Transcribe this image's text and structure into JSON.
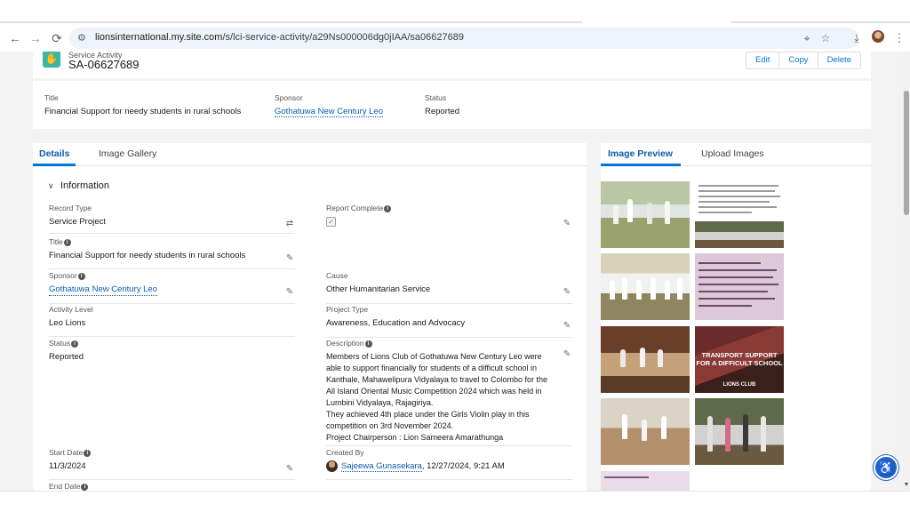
{
  "browser": {
    "url_host": "lionsinternational.my.site.com",
    "url_path": "/s/lci-service-activity/a29Ns000006dg0jIAA/sa06627689",
    "icons": [
      "back-icon",
      "forward-icon",
      "reload-icon",
      "site-info-icon",
      "location-icon",
      "star-icon",
      "download-icon",
      "menu-icon"
    ]
  },
  "record": {
    "object_type": "Service Activity",
    "name": "SA-06627689",
    "actions": [
      "Edit",
      "Copy",
      "Delete"
    ]
  },
  "highlights": [
    {
      "label": "Title",
      "value": "Financial Support for needy students in rural schools"
    },
    {
      "label": "Sponsor",
      "value": "Gothatuwa New Century Leo"
    },
    {
      "label": "Status",
      "value": "Reported"
    }
  ],
  "details": {
    "tabs": [
      "Details",
      "Image Gallery"
    ],
    "section": "Information",
    "fields": {
      "record_type": {
        "label": "Record Type",
        "value": "Service Project"
      },
      "report_complete": {
        "label": "Report Complete",
        "value": "✓"
      },
      "title": {
        "label": "Title",
        "value": "Financial Support for needy students in rural schools"
      },
      "sponsor": {
        "label": "Sponsor",
        "value": "Gothatuwa New Century Leo"
      },
      "cause": {
        "label": "Cause",
        "value": "Other Humanitarian Service"
      },
      "activity_level": {
        "label": "Activity Level",
        "value": "Leo Lions"
      },
      "project_type": {
        "label": "Project Type",
        "value": "Awareness, Education and Advocacy"
      },
      "status": {
        "label": "Status",
        "value": "Reported"
      },
      "description": {
        "label": "Description",
        "lines": [
          "Members of Lions Club of Gothatuwa New Century Leo were",
          "able to support financially for students of a difficult school in",
          "Kanthale, Mahawelipura Vidyalaya to travel to Colombo for the",
          "All Island Oriental Music Competition 2024 which was held in",
          "Lumbini Vidyalaya, Rajagiriya.",
          "They achieved 4th place under the Girls Violin play in this",
          "competition on 3rd November 2024.",
          "Project Chairperson : Lion Sameera Amarathunga"
        ]
      },
      "start_date": {
        "label": "Start Date",
        "value": "11/3/2024"
      },
      "created_by": {
        "label": "Created By",
        "user": "Sajeewa Gunasekara",
        "datetime": ", 12/27/2024, 9:21 AM"
      },
      "end_date": {
        "label": "End Date"
      }
    }
  },
  "images": {
    "tabs": [
      "Image Preview",
      "Upload Images"
    ],
    "poster_title": "TRANSPORT SUPPORT FOR A DIFFICULT SCHOOL",
    "poster_footer": "LIONS CLUB"
  },
  "colors": {
    "brand_link": "#0b5cab",
    "accent": "#0176d3",
    "object_icon": "#3bb5a8",
    "a11y_button": "#1d63c7"
  }
}
